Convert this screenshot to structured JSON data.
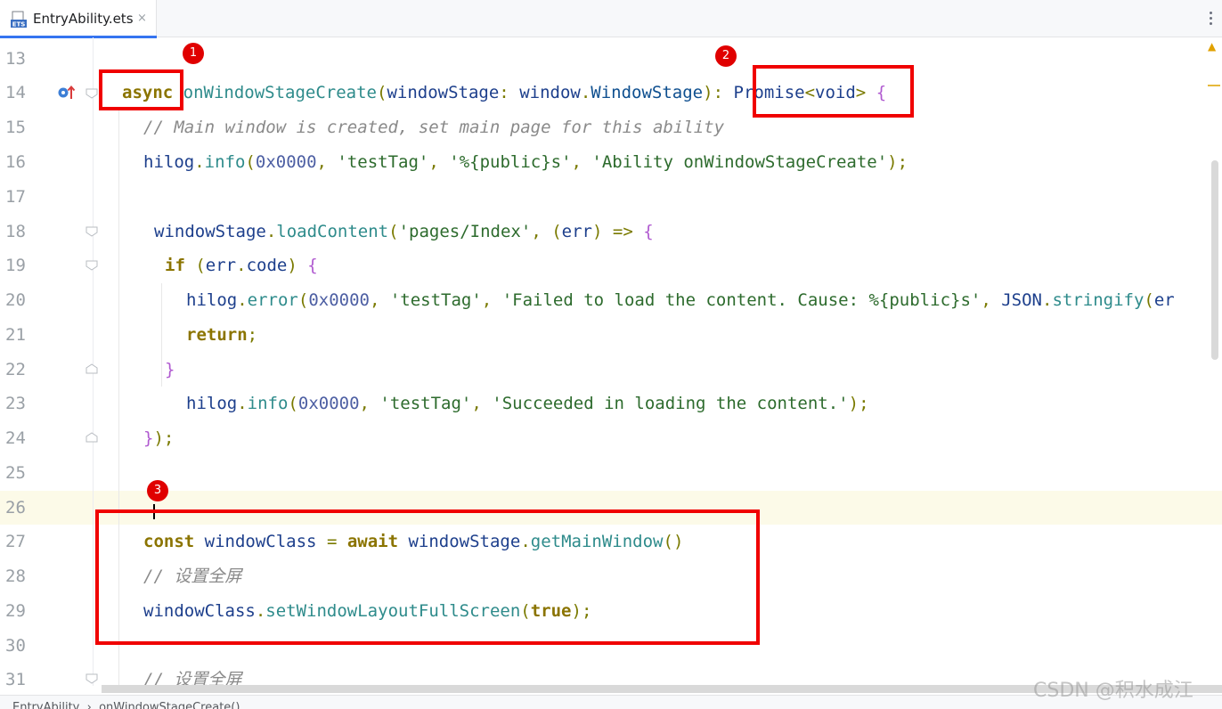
{
  "tab": {
    "title": "EntryAbility.ets",
    "icon": "ets-file-icon",
    "close": "×"
  },
  "line_numbers": [
    "13",
    "14",
    "15",
    "16",
    "17",
    "18",
    "19",
    "20",
    "21",
    "22",
    "23",
    "24",
    "25",
    "26",
    "27",
    "28",
    "29",
    "30",
    "31"
  ],
  "code": {
    "l14": {
      "kw": "async",
      "fn": "onWindowStageCreate",
      "p1": "(",
      "param": "windowStage",
      "colon": ":",
      "ns": "window",
      "dot": ".",
      "type": "WindowStage",
      "p2": ")",
      "colon2": ":",
      "ret": "Promise",
      "lt": "<",
      "void": "void",
      "gt": ">",
      "brace": "{"
    },
    "l15": {
      "comment": "// Main window is created, set main page for this ability"
    },
    "l16": {
      "obj": "hilog",
      "dot": ".",
      "fn": "info",
      "p1": "(",
      "n": "0x0000",
      "c1": ", ",
      "s1": "'testTag'",
      "c2": ", ",
      "s2": "'%{public}s'",
      "c3": ", ",
      "s3": "'Ability onWindowStageCreate'",
      "end": ");"
    },
    "l18": {
      "obj": "windowStage",
      "dot": ".",
      "fn": "loadContent",
      "p1": "(",
      "s1": "'pages/Index'",
      "c1": ", ",
      "p2": "(",
      "arg": "err",
      "p3": ")",
      "arrow": " => ",
      "brace": "{"
    },
    "l19": {
      "kw": "if",
      "p1": " (",
      "obj": "err",
      "dot": ".",
      "prop": "code",
      "p2": ") ",
      "brace": "{"
    },
    "l20": {
      "obj": "hilog",
      "dot": ".",
      "fn": "error",
      "p1": "(",
      "n": "0x0000",
      "c1": ", ",
      "s1": "'testTag'",
      "c2": ", ",
      "s2": "'Failed to load the content. Cause: %{public}s'",
      "c3": ", ",
      "obj2": "JSON",
      "dot2": ".",
      "fn2": "stringify",
      "p2": "(",
      "tail": "er"
    },
    "l21": {
      "kw": "return",
      "end": ";"
    },
    "l22": {
      "brace": "}"
    },
    "l23": {
      "obj": "hilog",
      "dot": ".",
      "fn": "info",
      "p1": "(",
      "n": "0x0000",
      "c1": ", ",
      "s1": "'testTag'",
      "c2": ", ",
      "s2": "'Succeeded in loading the content.'",
      "end": ");"
    },
    "l24": {
      "brace": "}",
      "end": ");"
    },
    "l27": {
      "kw": "const",
      "var": "windowClass",
      "eq": " = ",
      "kw2": "await",
      "obj": "windowStage",
      "dot": ".",
      "fn": "getMainWindow",
      "parens": "()"
    },
    "l28": {
      "comment": "// 设置全屏"
    },
    "l29": {
      "obj": "windowClass",
      "dot": ".",
      "fn": "setWindowLayoutFullScreen",
      "p1": "(",
      "kw": "true",
      "end": ");"
    },
    "l31": {
      "comment": "// 设置全屏"
    }
  },
  "annotations": {
    "badge1": "1",
    "badge2": "2",
    "badge3": "3",
    "box_color": "#f00000"
  },
  "breadcrumb": "EntryAbility  ›  onWindowStageCreate()",
  "watermark": "CSDN @积水成江"
}
